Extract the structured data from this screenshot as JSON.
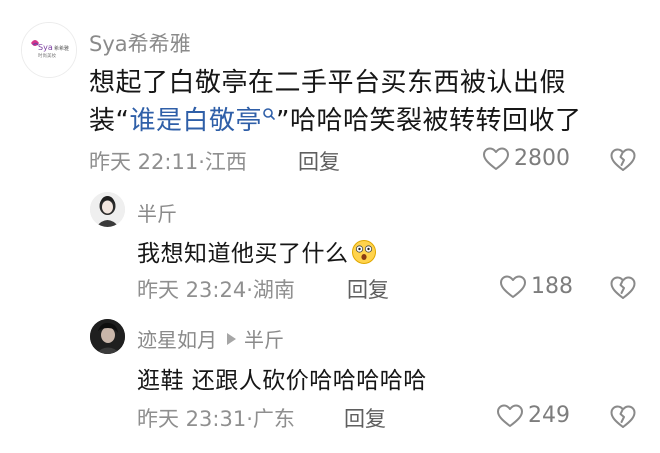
{
  "comments": [
    {
      "author": "Sya希希雅",
      "avatar_text": "Sya",
      "avatar_subtext": "希希雅",
      "avatar_caption": "时尚美妆",
      "text_line1": "想起了白敬亭在二手平台买东西被认出假",
      "text_line2_before": "装“",
      "text_link": "谁是白敬亭",
      "text_line2_after": "”哈哈哈笑裂被转转回收了",
      "meta": "昨天 22:11·江西",
      "reply_label": "回复",
      "likes": "2800"
    },
    {
      "author": "半斤",
      "text": "我想知道他买了什么",
      "meta": "昨天 23:24·湖南",
      "reply_label": "回复",
      "likes": "188"
    },
    {
      "author": "迹星如月",
      "reply_to": "半斤",
      "text": "逛鞋 还跟人砍价哈哈哈哈哈",
      "meta": "昨天 23:31·广东",
      "reply_label": "回复",
      "likes": "249"
    }
  ],
  "colors": {
    "link": "#2f5fa8",
    "muted": "#8f8f8f",
    "text": "#161616",
    "brand_pink": "#d6338a"
  }
}
